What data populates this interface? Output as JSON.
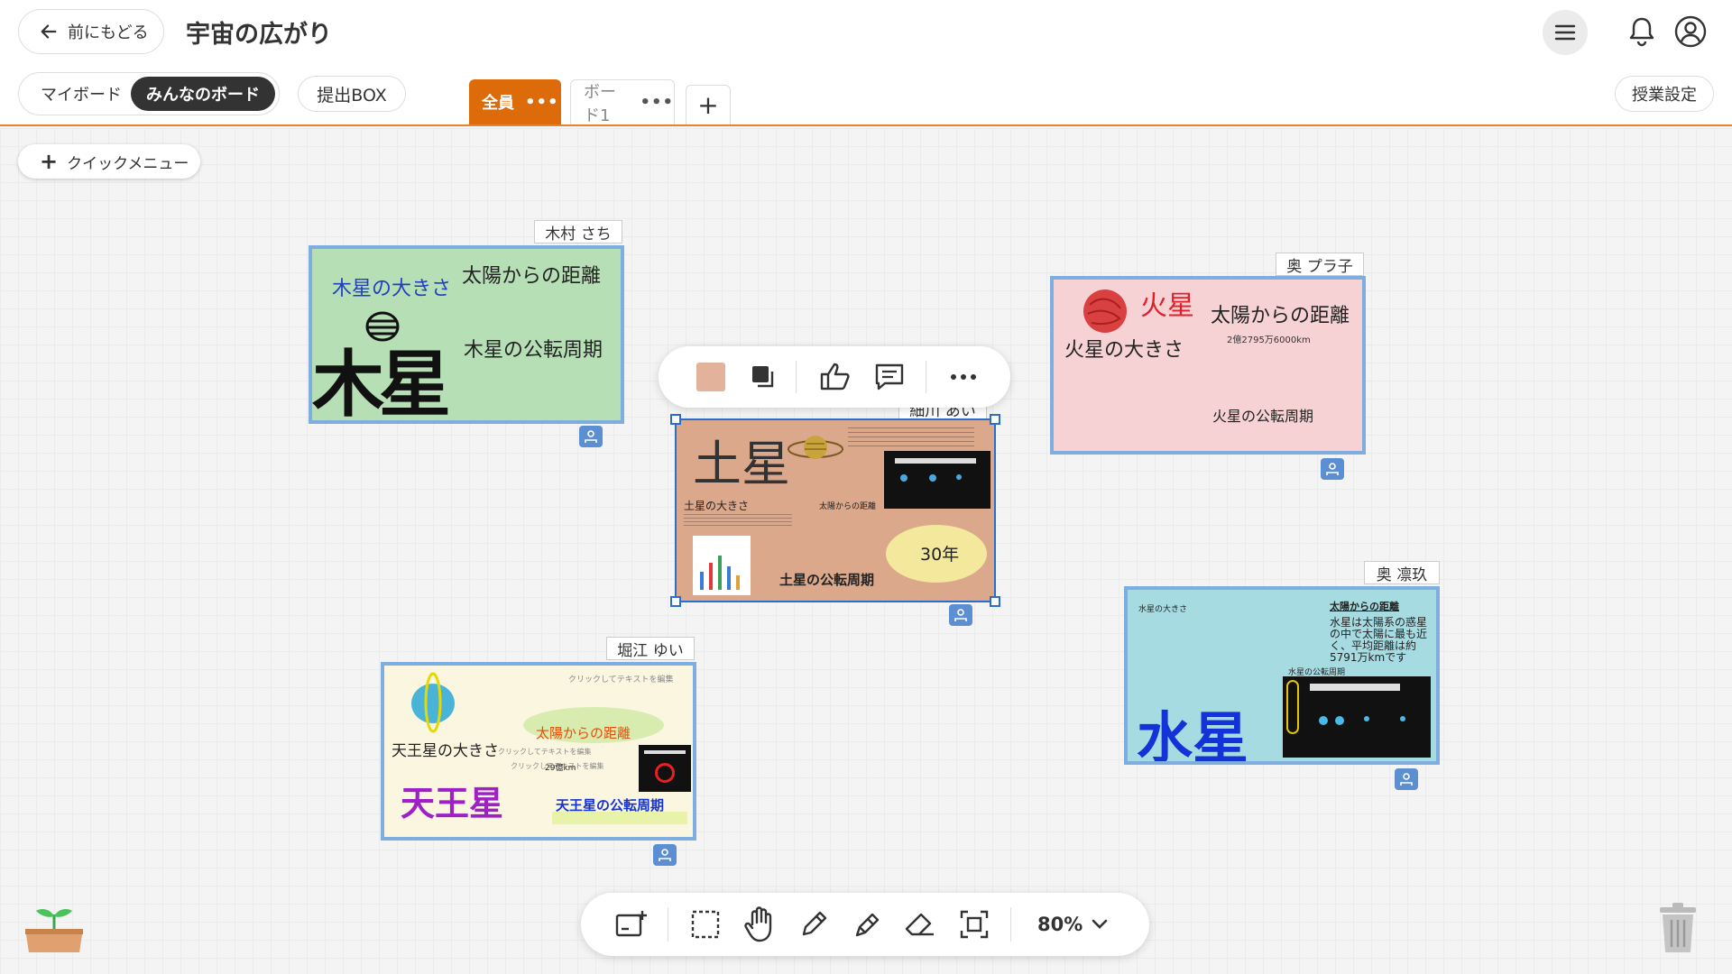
{
  "header": {
    "back_label": "前にもどる",
    "title": "宇宙の広がり",
    "board_toggle": {
      "my": "マイボード",
      "all": "みんなのボード"
    },
    "submit_box": "提出BOX",
    "tabs": [
      {
        "label": "全員",
        "active": true
      },
      {
        "label": "ボード1",
        "active": false
      }
    ],
    "tab_more": "•••",
    "add_tab": "+",
    "class_settings": "授業設定"
  },
  "quick_menu": {
    "icon": "+",
    "label": "クイックメニュー"
  },
  "cards": {
    "jupiter": {
      "owner": "木村 さち",
      "bg": "#b6dfb5",
      "texts": {
        "size": "木星の大きさ",
        "distance": "太陽からの距離",
        "period": "木星の公転周期",
        "name": "木星"
      }
    },
    "mars": {
      "owner": "奥 プラ子",
      "bg": "#f7d2d4",
      "texts": {
        "planet": "火星",
        "distance": "太陽からの距離",
        "distance_value": "2億2795万6000km",
        "size": "火星の大きさ",
        "period": "火星の公転周期"
      }
    },
    "saturn": {
      "owner": "細川 あい",
      "bg": "#dba88c",
      "texts": {
        "title": "土星",
        "size": "土星の大きさ",
        "distance": "太陽からの距離",
        "period_years": "30年",
        "period": "土星の公転周期"
      }
    },
    "mercury": {
      "owner": "奥 凛玖",
      "bg": "#a6dbe2",
      "texts": {
        "size": "水星の大きさ",
        "distance": "太陽からの距離",
        "distance_text": "水星は太陽系の惑星の中で太陽に最も近く、平均距離は約5791万kmです",
        "period": "水星の公転周期",
        "name": "水星"
      }
    },
    "uranus": {
      "owner": "堀江 ゆい",
      "bg": "#fbf6e0",
      "texts": {
        "placeholder": "クリックしてテキストを編集",
        "size": "天王星の大きさ",
        "distance": "太陽からの距離",
        "distance_value": "29億km",
        "name": "天王星",
        "period": "天王星の公転周期"
      }
    }
  },
  "card_toolbar": {
    "color": "#e2b29a",
    "icons": [
      "color-swatch",
      "layer-order-icon",
      "like-icon",
      "comment-icon",
      "more-icon"
    ]
  },
  "bottom_toolbar": {
    "tools": [
      "add-card-icon",
      "select-area-icon",
      "hand-icon",
      "pen-icon",
      "marker-icon",
      "eraser-icon",
      "capture-icon"
    ],
    "zoom": "80%"
  },
  "colors": {
    "accent": "#de6b0a",
    "card_border": "#7eaee0",
    "badge": "#5b8fd1"
  }
}
